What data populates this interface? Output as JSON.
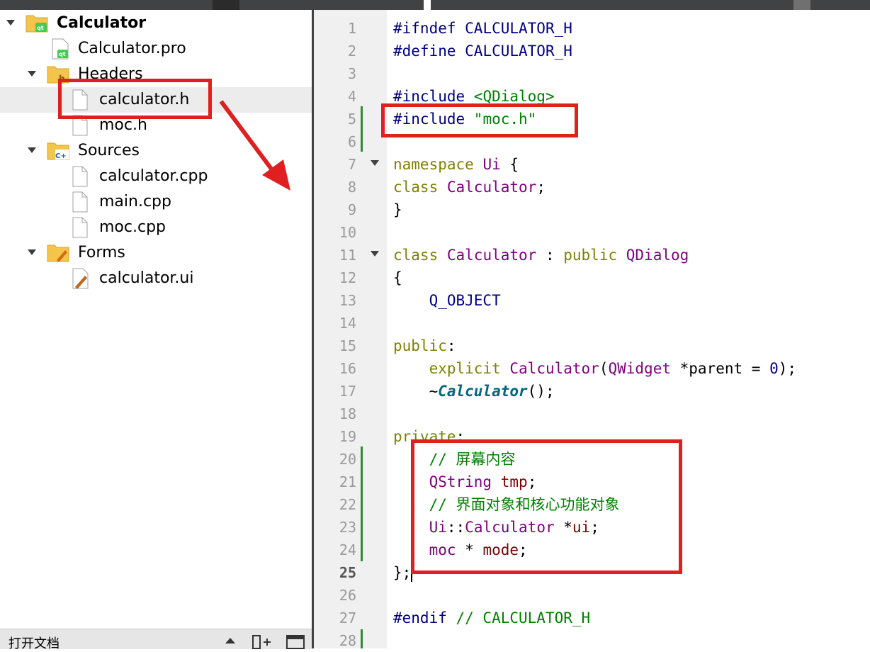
{
  "tree": {
    "project": "Calculator",
    "pro_file": "Calculator.pro",
    "headers_label": "Headers",
    "headers": [
      "calculator.h",
      "moc.h"
    ],
    "sources_label": "Sources",
    "sources": [
      "calculator.cpp",
      "main.cpp",
      "moc.cpp"
    ],
    "forms_label": "Forms",
    "forms": [
      "calculator.ui"
    ]
  },
  "bottom_bar": {
    "label": "打开文档"
  },
  "editor": {
    "current_line": "25",
    "line_numbers": [
      "1",
      "2",
      "3",
      "4",
      "5",
      "6",
      "7",
      "8",
      "9",
      "10",
      "11",
      "12",
      "13",
      "14",
      "15",
      "16",
      "17",
      "18",
      "19",
      "20",
      "21",
      "22",
      "23",
      "24",
      "25",
      "26",
      "27",
      "28"
    ],
    "code": {
      "l1a": "#ifndef",
      "l1b": " CALCULATOR_H",
      "l2a": "#define",
      "l2b": " CALCULATOR_H",
      "l4a": "#include",
      "l4b": " <QDialog>",
      "l5a": "#include",
      "l5b": " \"moc.h\"",
      "l7a": "namespace",
      "l7b": " ",
      "l7c": "Ui",
      "l7d": " {",
      "l8a": "class",
      "l8b": " ",
      "l8c": "Calculator",
      "l8d": ";",
      "l9": "}",
      "l11a": "class",
      "l11b": " ",
      "l11c": "Calculator",
      "l11d": " : ",
      "l11e": "public",
      "l11f": " ",
      "l11g": "QDialog",
      "l12": "{",
      "l13": "    Q_OBJECT",
      "l15a": "public",
      "l15b": ":",
      "l16a": "    ",
      "l16b": "explicit",
      "l16c": " ",
      "l16d": "Calculator",
      "l16e": "(",
      "l16f": "QWidget",
      "l16g": " *parent = ",
      "l16h": "0",
      "l16i": ");",
      "l17a": "    ~",
      "l17b": "Calculator",
      "l17c": "();",
      "l19a": "private",
      "l19b": ":",
      "l20": "    // 屏幕内容",
      "l21a": "    ",
      "l21b": "QString",
      "l21c": " ",
      "l21d": "tmp",
      "l21e": ";",
      "l22": "    // 界面对象和核心功能对象",
      "l23a": "    ",
      "l23b": "Ui",
      "l23c": "::",
      "l23d": "Calculator",
      "l23e": " *",
      "l23f": "ui",
      "l23g": ";",
      "l24a": "    ",
      "l24b": "moc",
      "l24c": " * ",
      "l24d": "mode",
      "l24e": ";",
      "l25": "};",
      "l27a": "#endif",
      "l27b": " // CALCULATOR_H"
    }
  },
  "colors": {
    "annotation": "#e02020",
    "preprocessor": "#000080",
    "string": "#008000",
    "keyword": "#808000",
    "type": "#800080",
    "member": "#800000",
    "modified_marker": "#2e8b2e"
  }
}
